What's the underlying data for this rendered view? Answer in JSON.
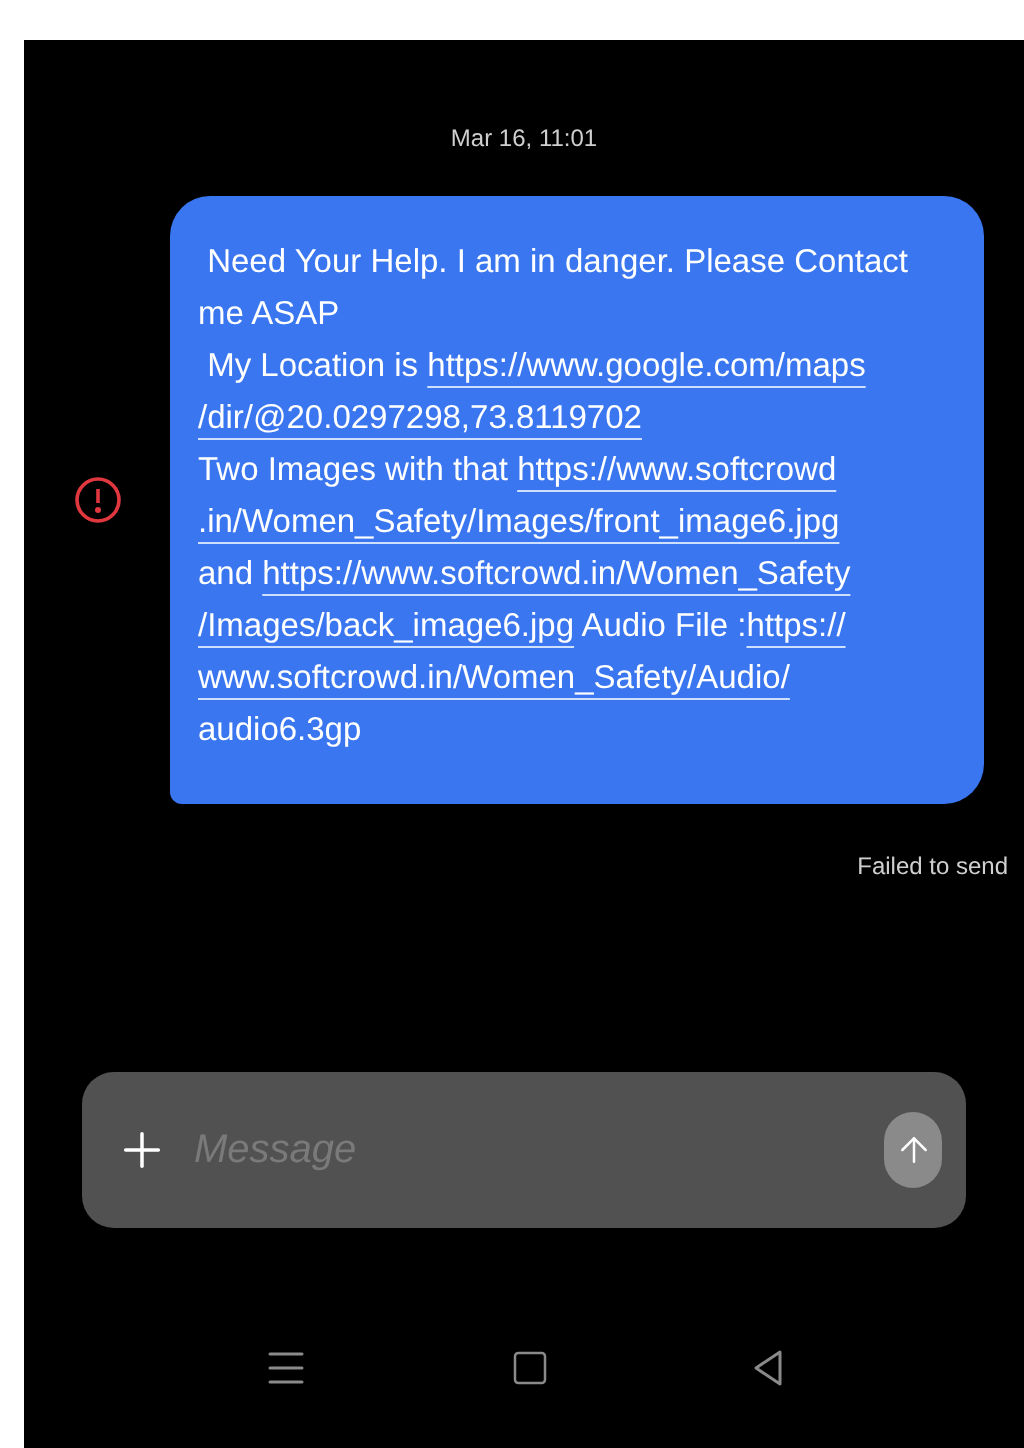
{
  "timestamp": "Mar 16, 11:01",
  "message": {
    "failed": true,
    "lines": [
      [
        {
          "kind": "text",
          "text": " Need Your Help. I am in danger. Please Contact"
        }
      ],
      [
        {
          "kind": "text",
          "text": "me ASAP"
        }
      ],
      [
        {
          "kind": "text",
          "text": " My Location is "
        },
        {
          "kind": "link",
          "text": "https://www.google.com/maps"
        }
      ],
      [
        {
          "kind": "link",
          "text": "/dir/@20.0297298,73.8119702"
        }
      ],
      [
        {
          "kind": "text",
          "text": "Two Images with that "
        },
        {
          "kind": "link",
          "text": "https://www.softcrowd"
        }
      ],
      [
        {
          "kind": "link",
          "text": ".in/Women_Safety/Images/front_image6.jpg"
        }
      ],
      [
        {
          "kind": "text",
          "text": "and "
        },
        {
          "kind": "link",
          "text": "https://www.softcrowd.in/Women_Safety"
        }
      ],
      [
        {
          "kind": "link",
          "text": "/Images/back_image6.jpg"
        },
        {
          "kind": "text",
          "text": " Audio File :"
        },
        {
          "kind": "link",
          "text": "https://"
        }
      ],
      [
        {
          "kind": "link",
          "text": "www.softcrowd.in/Women_Safety/Audio/"
        }
      ],
      [
        {
          "kind": "text",
          "text": "audio6.3gp"
        }
      ]
    ],
    "status": "Failed to send"
  },
  "composer": {
    "placeholder": "Message"
  }
}
